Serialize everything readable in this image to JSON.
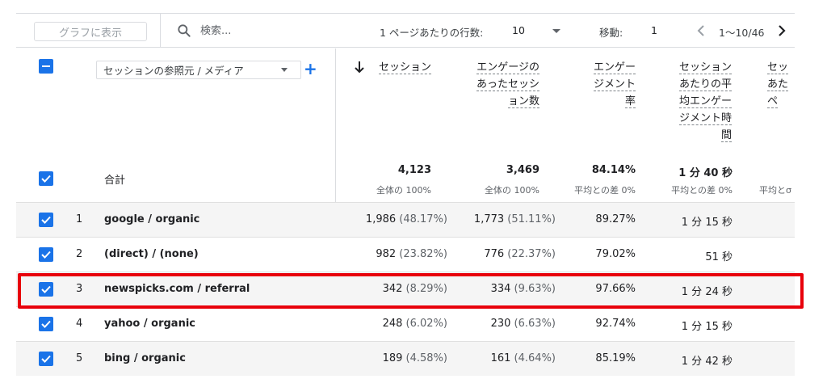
{
  "toolbar": {
    "graph_button": "グラフに表示",
    "search_placeholder": "検索...",
    "rows_per_page_label": "1 ページあたりの行数:",
    "rows_per_page_value": "10",
    "goto_label": "移動:",
    "goto_value": "1",
    "range_text": "1〜10/46"
  },
  "header": {
    "dimension_select": "セッションの参照元 / メディア",
    "columns": [
      {
        "label": "セッション",
        "sorted": "desc"
      },
      {
        "label": "エンゲージの\nあったセッシ\nョン数"
      },
      {
        "label": "エンゲー\nジメント\n率"
      },
      {
        "label": "セッション\nあたりの平\n均エンゲー\nジメント時\n間"
      },
      {
        "label": "セッ\nあた\nペ"
      }
    ]
  },
  "totals": {
    "label": "合計",
    "values": [
      "4,123",
      "3,469",
      "84.14%",
      "1 分 40 秒",
      ""
    ],
    "subs": [
      "全体の 100%",
      "全体の 100%",
      "平均との差 0%",
      "平均との差 0%",
      "平均とσ"
    ]
  },
  "rows": [
    {
      "index": "1",
      "dim": "google / organic",
      "sessions": "1,986",
      "sessions_pct": "(48.17%)",
      "engaged": "1,773",
      "engaged_pct": "(51.11%)",
      "rate": "89.27%",
      "time": "1 分 15 秒"
    },
    {
      "index": "2",
      "dim": "(direct) / (none)",
      "sessions": "982",
      "sessions_pct": "(23.82%)",
      "engaged": "776",
      "engaged_pct": "(22.37%)",
      "rate": "79.02%",
      "time": "51 秒"
    },
    {
      "index": "3",
      "dim": "newspicks.com / referral",
      "sessions": "342",
      "sessions_pct": "(8.29%)",
      "engaged": "334",
      "engaged_pct": "(9.63%)",
      "rate": "97.66%",
      "time": "1 分 24 秒"
    },
    {
      "index": "4",
      "dim": "yahoo / organic",
      "sessions": "248",
      "sessions_pct": "(6.02%)",
      "engaged": "230",
      "engaged_pct": "(6.63%)",
      "rate": "92.74%",
      "time": "1 分 15 秒"
    },
    {
      "index": "5",
      "dim": "bing / organic",
      "sessions": "189",
      "sessions_pct": "(4.58%)",
      "engaged": "161",
      "engaged_pct": "(4.64%)",
      "rate": "85.19%",
      "time": "1 分 42 秒"
    }
  ],
  "highlight_row": "3",
  "colors": {
    "accent": "#1a73e8",
    "highlight": "#e8000b"
  },
  "icons": [
    "search-icon",
    "chevron-left-icon",
    "chevron-right-icon",
    "arrow-down-icon",
    "plus-icon",
    "checkbox-checked-icon",
    "checkbox-indeterminate-icon",
    "caret-down-icon"
  ]
}
